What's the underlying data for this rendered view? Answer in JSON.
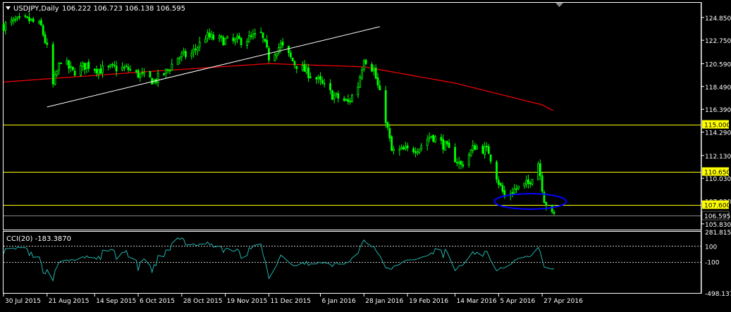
{
  "window": {
    "title": "USDJPY,Daily",
    "ohlc": "106.222 106.723 106.138 106.595"
  },
  "indicator": {
    "label": "CCI(20) -183.3870"
  },
  "colors": {
    "background": "#000000",
    "frame": "#ffffff",
    "candle": "#00ff00",
    "moving_average": "#ff0000",
    "trendline": "#ffffff",
    "horizontal_levels": "#ffff00",
    "bid_line": "#c0c0c0",
    "cci_line": "#20b2aa",
    "ellipse": "#0000ff",
    "text": "#ffffff"
  },
  "chart_data": [
    {
      "type": "candlestick",
      "title": "USDJPY,Daily",
      "ylim": [
        105.3,
        126.2
      ],
      "y_ticks": [
        "124.850",
        "122.750",
        "120.590",
        "118.490",
        "116.390",
        "114.290",
        "112.130",
        "110.030",
        "107.930",
        "105.830"
      ],
      "x_ticks": [
        "30 Jul 2015",
        "21 Aug 2015",
        "14 Sep 2015",
        "6 Oct 2015",
        "28 Oct 2015",
        "19 Nov 2015",
        "11 Dec 2015",
        "6 Jan 2016",
        "28 Jan 2016",
        "19 Feb 2016",
        "14 Mar 2016",
        "5 Apr 2016",
        "27 Apr 2016"
      ],
      "current_price": "106.595",
      "horizontal_levels": [
        "115.000",
        "110.650",
        "107.600"
      ],
      "close_path": [
        [
          "30 Jul 2015",
          124.1
        ],
        [
          "5 Aug 2015",
          124.5
        ],
        [
          "12 Aug 2015",
          124.6
        ],
        [
          "18 Aug 2015",
          124.0
        ],
        [
          "21 Aug 2015",
          122.0
        ],
        [
          "24 Aug 2015",
          118.6
        ],
        [
          "28 Aug 2015",
          121.0
        ],
        [
          "3 Sep 2015",
          119.8
        ],
        [
          "10 Sep 2015",
          120.5
        ],
        [
          "17 Sep 2015",
          120.0
        ],
        [
          "24 Sep 2015",
          120.2
        ],
        [
          "1 Oct 2015",
          120.1
        ],
        [
          "6 Oct 2015",
          119.6
        ],
        [
          "14 Oct 2015",
          119.0
        ],
        [
          "20 Oct 2015",
          119.8
        ],
        [
          "26 Oct 2015",
          121.2
        ],
        [
          "2 Nov 2015",
          121.5
        ],
        [
          "9 Nov 2015",
          123.1
        ],
        [
          "16 Nov 2015",
          122.8
        ],
        [
          "23 Nov 2015",
          122.6
        ],
        [
          "1 Dec 2015",
          122.9
        ],
        [
          "7 Dec 2015",
          123.3
        ],
        [
          "11 Dec 2015",
          121.2
        ],
        [
          "17 Dec 2015",
          122.3
        ],
        [
          "24 Dec 2015",
          120.6
        ],
        [
          "4 Jan 2016",
          119.2
        ],
        [
          "12 Jan 2016",
          117.7
        ],
        [
          "20 Jan 2016",
          117.0
        ],
        [
          "25 Jan 2016",
          118.6
        ],
        [
          "28 Jan 2016",
          121.2
        ],
        [
          "2 Feb 2016",
          120.0
        ],
        [
          "8 Feb 2016",
          115.5
        ],
        [
          "11 Feb 2016",
          112.5
        ],
        [
          "19 Feb 2016",
          112.6
        ],
        [
          "25 Feb 2016",
          112.9
        ],
        [
          "2 Mar 2016",
          114.0
        ],
        [
          "9 Mar 2016",
          113.0
        ],
        [
          "17 Mar 2016",
          111.2
        ],
        [
          "24 Mar 2016",
          113.0
        ],
        [
          "31 Mar 2016",
          112.5
        ],
        [
          "5 Apr 2016",
          109.7
        ],
        [
          "8 Apr 2016",
          108.3
        ],
        [
          "13 Apr 2016",
          109.0
        ],
        [
          "20 Apr 2016",
          109.5
        ],
        [
          "25 Apr 2016",
          111.5
        ],
        [
          "28 Apr 2016",
          108.1
        ],
        [
          "2 May 2016",
          106.6
        ]
      ],
      "moving_average_path": [
        [
          "30 Jul 2015",
          118.9
        ],
        [
          "6 Oct 2015",
          119.8
        ],
        [
          "11 Dec 2015",
          120.6
        ],
        [
          "28 Jan 2016",
          120.3
        ],
        [
          "14 Mar 2016",
          118.8
        ],
        [
          "27 Apr 2016",
          116.8
        ],
        [
          "2 May 2016",
          116.3
        ]
      ],
      "trendline": [
        [
          "21 Aug 2015",
          116.6
        ],
        [
          "5 Feb 2016",
          124.0
        ]
      ],
      "annotation": "ellipse around 107.6 support, 5 Apr 2016 – 2 May 2016"
    },
    {
      "type": "line",
      "title": "CCI(20) -183.3870",
      "ylim": [
        -498.1371,
        281.8159
      ],
      "y_ticks": [
        "281.8159",
        "100",
        "-100",
        "-498.1371"
      ],
      "levels": [
        100,
        -100
      ],
      "last_value": -183.387
    }
  ]
}
